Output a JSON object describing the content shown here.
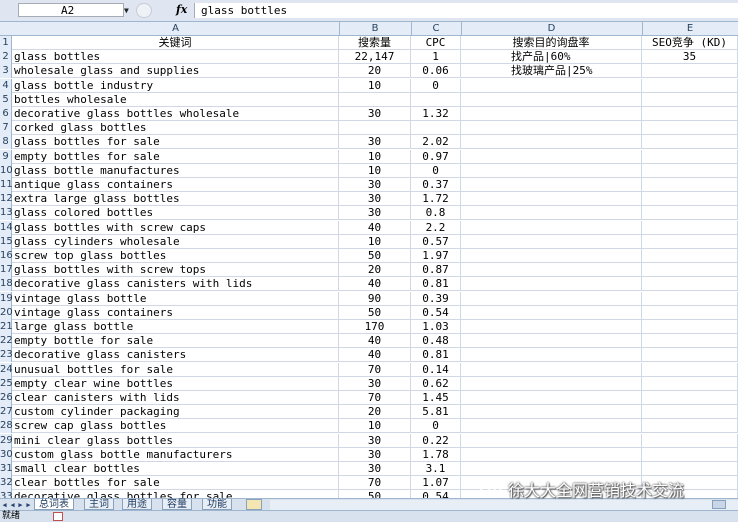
{
  "formula_bar": {
    "cell_ref": "A2",
    "fx": "fx",
    "value": "glass bottles"
  },
  "columns": [
    "A",
    "B",
    "C",
    "D",
    "E"
  ],
  "headers": {
    "row": "1",
    "A": "关键词",
    "B": "搜索量",
    "C": "CPC",
    "D": "搜索目的询盘率",
    "E": "SEO竞争 (KD)"
  },
  "rows": [
    {
      "n": "2",
      "A": "glass bottles",
      "B": "22,147",
      "C": "1",
      "D": "找产品|60%",
      "E": "35"
    },
    {
      "n": "3",
      "A": "wholesale glass and supplies",
      "B": "20",
      "C": "0.06",
      "D": "找玻璃产品|25%",
      "E": ""
    },
    {
      "n": "4",
      "A": "glass bottle industry",
      "B": "10",
      "C": "0",
      "D": "",
      "E": ""
    },
    {
      "n": "5",
      "A": "bottles wholesale",
      "B": "",
      "C": "",
      "D": "",
      "E": ""
    },
    {
      "n": "6",
      "A": "decorative glass bottles wholesale",
      "B": "30",
      "C": "1.32",
      "D": "",
      "E": ""
    },
    {
      "n": "7",
      "A": "corked glass bottles",
      "B": "",
      "C": "",
      "D": "",
      "E": ""
    },
    {
      "n": "8",
      "A": "glass bottles for sale",
      "B": "30",
      "C": "2.02",
      "D": "",
      "E": ""
    },
    {
      "n": "9",
      "A": "empty bottles for sale",
      "B": "10",
      "C": "0.97",
      "D": "",
      "E": ""
    },
    {
      "n": "10",
      "A": "glass bottle manufactures",
      "B": "10",
      "C": "0",
      "D": "",
      "E": ""
    },
    {
      "n": "11",
      "A": "antique glass containers",
      "B": "30",
      "C": "0.37",
      "D": "",
      "E": ""
    },
    {
      "n": "12",
      "A": "extra large glass bottles",
      "B": "30",
      "C": "1.72",
      "D": "",
      "E": ""
    },
    {
      "n": "13",
      "A": "glass colored bottles",
      "B": "30",
      "C": "0.8",
      "D": "",
      "E": ""
    },
    {
      "n": "14",
      "A": "glass bottles with screw caps",
      "B": "40",
      "C": "2.2",
      "D": "",
      "E": ""
    },
    {
      "n": "15",
      "A": "glass cylinders wholesale",
      "B": "10",
      "C": "0.57",
      "D": "",
      "E": ""
    },
    {
      "n": "16",
      "A": "screw top glass bottles",
      "B": "50",
      "C": "1.97",
      "D": "",
      "E": ""
    },
    {
      "n": "17",
      "A": "glass bottles with screw tops",
      "B": "20",
      "C": "0.87",
      "D": "",
      "E": ""
    },
    {
      "n": "18",
      "A": "decorative glass canisters with lids",
      "B": "40",
      "C": "0.81",
      "D": "",
      "E": ""
    },
    {
      "n": "19",
      "A": "vintage glass bottle",
      "B": "90",
      "C": "0.39",
      "D": "",
      "E": ""
    },
    {
      "n": "20",
      "A": "vintage glass containers",
      "B": "50",
      "C": "0.54",
      "D": "",
      "E": ""
    },
    {
      "n": "21",
      "A": "large glass bottle",
      "B": "170",
      "C": "1.03",
      "D": "",
      "E": ""
    },
    {
      "n": "22",
      "A": "empty bottle for sale",
      "B": "40",
      "C": "0.48",
      "D": "",
      "E": ""
    },
    {
      "n": "23",
      "A": "decorative glass canisters",
      "B": "40",
      "C": "0.81",
      "D": "",
      "E": ""
    },
    {
      "n": "24",
      "A": "unusual bottles for sale",
      "B": "70",
      "C": "0.14",
      "D": "",
      "E": ""
    },
    {
      "n": "25",
      "A": "empty clear wine bottles",
      "B": "30",
      "C": "0.62",
      "D": "",
      "E": ""
    },
    {
      "n": "26",
      "A": "clear canisters with lids",
      "B": "70",
      "C": "1.45",
      "D": "",
      "E": ""
    },
    {
      "n": "27",
      "A": "custom cylinder packaging",
      "B": "20",
      "C": "5.81",
      "D": "",
      "E": ""
    },
    {
      "n": "28",
      "A": "screw cap glass bottles",
      "B": "10",
      "C": "0",
      "D": "",
      "E": ""
    },
    {
      "n": "29",
      "A": "mini clear glass bottles",
      "B": "30",
      "C": "0.22",
      "D": "",
      "E": ""
    },
    {
      "n": "30",
      "A": "custom glass bottle manufacturers",
      "B": "30",
      "C": "1.78",
      "D": "",
      "E": ""
    },
    {
      "n": "31",
      "A": "small clear bottles",
      "B": "30",
      "C": "3.1",
      "D": "",
      "E": ""
    },
    {
      "n": "32",
      "A": "clear bottles for sale",
      "B": "70",
      "C": "1.07",
      "D": "",
      "E": ""
    },
    {
      "n": "33",
      "A": "decorative glass bottles for sale",
      "B": "50",
      "C": "0.54",
      "D": "",
      "E": ""
    }
  ],
  "sheet_tabs": [
    "总词表",
    "主词",
    "用途",
    "容量",
    "功能"
  ],
  "active_tab": "总词表",
  "status_text": "就绪",
  "watermark": "徐大大全网营销技术交流",
  "colors": {
    "header_bg": "#e4ecf7",
    "grid_line": "#d0d7e5",
    "frame_blue": "#9eb6ce"
  }
}
